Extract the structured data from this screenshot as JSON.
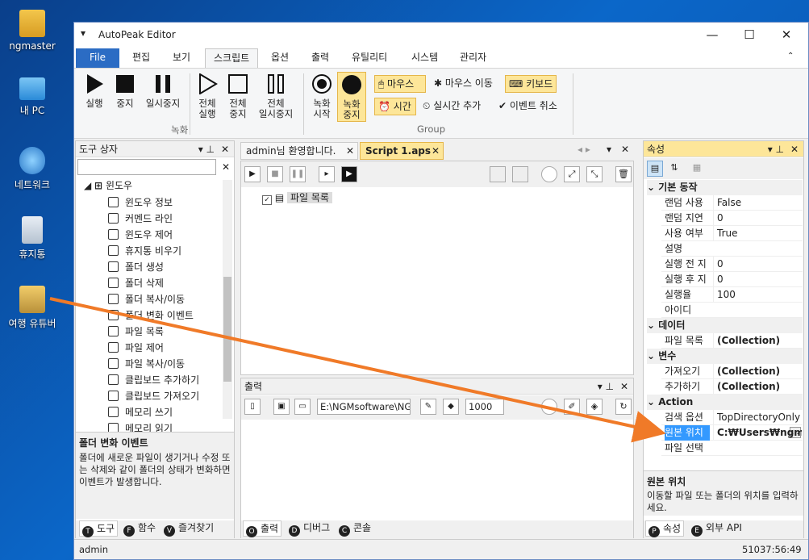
{
  "desktop": {
    "icons": [
      {
        "label": "ngmaster",
        "icon": "user-folder-icon"
      },
      {
        "label": "내 PC",
        "icon": "computer-icon"
      },
      {
        "label": "네트워크",
        "icon": "network-icon"
      },
      {
        "label": "휴지통",
        "icon": "recycle-bin-icon"
      },
      {
        "label": "여행 유튜버",
        "icon": "folder-icon"
      }
    ]
  },
  "window": {
    "title": "AutoPeak Editor",
    "controls": {
      "minimize": "—",
      "maximize": "☐",
      "close": "✕"
    }
  },
  "menu_tabs": [
    "File",
    "편집",
    "보기",
    "스크립트",
    "옵션",
    "출력",
    "유틸리티",
    "시스템",
    "관리자"
  ],
  "ribbon": {
    "record_group_label": "녹화",
    "buttons": {
      "run": "실행",
      "stop": "중지",
      "pause": "일시중지",
      "run_all_1": "전체",
      "run_all_2": "실행",
      "stop_all_1": "전체",
      "stop_all_2": "중지",
      "pause_all_1": "전체",
      "pause_all_2": "일시중지",
      "rec_start_1": "녹화",
      "rec_start_2": "시작",
      "rec_stop_1": "녹화",
      "rec_stop_2": "중지"
    },
    "group_label": "Group",
    "options": {
      "mouse": "마우스",
      "mouse_move": "마우스 이동",
      "keyboard": "키보드",
      "time": "시간",
      "realtime_add": "실시간 추가",
      "event_cancel": "이벤트 취소"
    }
  },
  "toolbox": {
    "title": "도구 상자",
    "root": "윈도우",
    "items": [
      "윈도우 정보",
      "커멘드 라인",
      "윈도우 제어",
      "휴지통 비우기",
      "폴더 생성",
      "폴더 삭제",
      "폴더 복사/이동",
      "폴더 변화 이벤트",
      "파일 목록",
      "파일 제어",
      "파일 복사/이동",
      "클립보드 추가하기",
      "클립보드 가져오기",
      "메모리 쓰기",
      "메모리 읽기"
    ],
    "desc_title": "폴더 변화 이벤트",
    "desc_text": "폴더에 새로운 파일이 생기거나 수정 또는 삭제와 같이 폴더의 상태가 변화하면 이벤트가 발생합니다.",
    "bottom_tabs": [
      {
        "badge": "T",
        "label": "도구"
      },
      {
        "badge": "F",
        "label": "함수"
      },
      {
        "badge": "V",
        "label": "즐겨찾기"
      }
    ]
  },
  "editor": {
    "tabs": [
      "admin님 환영합니다.",
      "Script 1.aps"
    ],
    "script_item": "파일 목록"
  },
  "output": {
    "title": "출력",
    "path": "E:\\NGMsoftware\\NG",
    "interval": "1000",
    "bottom_tabs": [
      {
        "badge": "O",
        "label": "출력"
      },
      {
        "badge": "D",
        "label": "디버그"
      },
      {
        "badge": "C",
        "label": "콘솔"
      }
    ]
  },
  "properties": {
    "title": "속성",
    "categories": [
      {
        "name": "기본 동작",
        "rows": [
          {
            "k": "랜덤 사용",
            "v": "False"
          },
          {
            "k": "랜덤 지연",
            "v": "0"
          },
          {
            "k": "사용 여부",
            "v": "True"
          },
          {
            "k": "설명",
            "v": ""
          },
          {
            "k": "실행 전 지",
            "v": "0"
          },
          {
            "k": "실행 후 지",
            "v": "0"
          },
          {
            "k": "실행율",
            "v": "100"
          },
          {
            "k": "아이디",
            "v": ""
          }
        ]
      },
      {
        "name": "데이터",
        "rows": [
          {
            "k": "파일 목록",
            "v": "(Collection)"
          }
        ]
      },
      {
        "name": "변수",
        "rows": [
          {
            "k": "가져오기",
            "v": "(Collection)"
          },
          {
            "k": "추가하기",
            "v": "(Collection)"
          }
        ]
      },
      {
        "name": "Action",
        "rows": [
          {
            "k": "검색 옵션",
            "v": "TopDirectoryOnly"
          },
          {
            "k": "원본 위치",
            "v": "C:₩Users₩ngma"
          },
          {
            "k": "파일 선택",
            "v": ""
          }
        ]
      }
    ],
    "desc_title": "원본 위치",
    "desc_text": "이동할 파일 또는 폴더의 위치를 입력하세요.",
    "bottom_tabs": [
      {
        "badge": "P",
        "label": "속성"
      },
      {
        "badge": "E",
        "label": "외부 API"
      }
    ]
  },
  "status": {
    "user": "admin",
    "time": "51037:56:49"
  },
  "colors": {
    "accent": "#2b6cc4",
    "highlight": "#fde699",
    "selected": "#3399ff",
    "arrow": "#f07a28"
  }
}
